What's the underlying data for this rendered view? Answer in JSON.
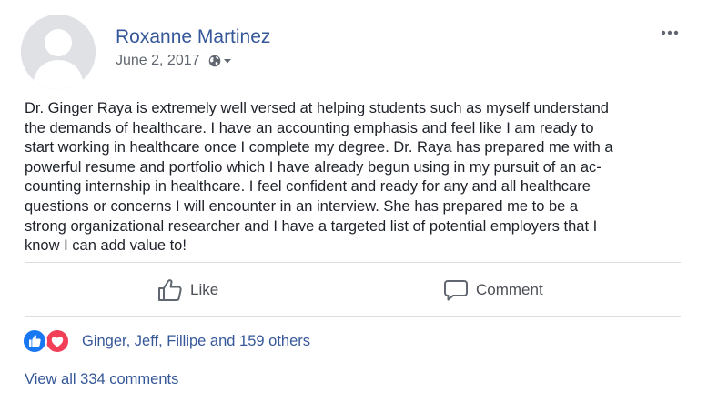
{
  "post": {
    "author": "Roxanne Martinez",
    "date": "June 2, 2017",
    "audience_icon": "globe-icon",
    "text_lines": [
      "Dr. Ginger Raya is extremely well versed at helping students such as myself understand",
      "the demands of healthcare. I have an accounting emphasis and feel like I am ready to",
      "start working in healthcare once I complete my degree.  Dr. Raya has prepared me with a",
      "powerful resume and portfolio which I have already begun using in my pursuit of an ac-",
      "counting internship in healthcare. I feel confident and ready for any and all healthcare",
      "questions or concerns I will encounter in an interview. She has prepared me to be a",
      "strong organizational researcher and I have a targeted list of potential employers that I",
      "know I can add value to!"
    ]
  },
  "actions": {
    "like_label": "Like",
    "comment_label": "Comment"
  },
  "reactions": {
    "icons": [
      "like-reaction-icon",
      "love-reaction-icon"
    ],
    "summary": "Ginger, Jeff, Fillipe and 159 others"
  },
  "comments": {
    "view_all": "View all 334 comments"
  },
  "colors": {
    "link": "#365899",
    "secondary_text": "#606770",
    "action_text": "#4b4f56",
    "like_blue": "#1877f2",
    "love_red": "#f33e58",
    "avatar_bg": "#dfe1e5",
    "divider": "#dadde1"
  }
}
